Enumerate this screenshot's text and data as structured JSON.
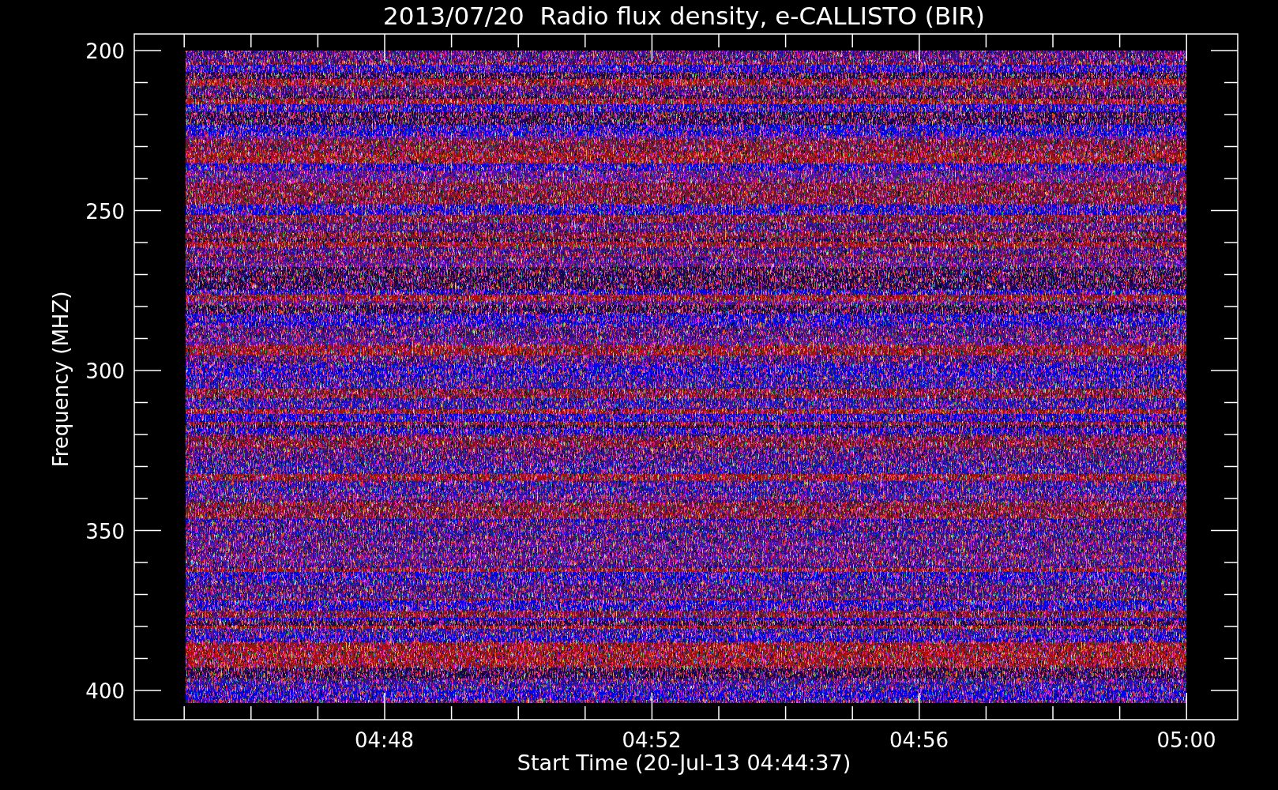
{
  "title": "2013/07/20  Radio flux density, e-CALLISTO (BIR)",
  "y_axis": {
    "label": "Frequency (MHZ)",
    "ticks": [
      "200",
      "250",
      "300",
      "350",
      "400"
    ]
  },
  "x_axis": {
    "label": "Start Time (20-Jul-13 04:44:37)",
    "ticks": [
      "04:48",
      "04:52",
      "04:56",
      "05:00"
    ]
  }
}
